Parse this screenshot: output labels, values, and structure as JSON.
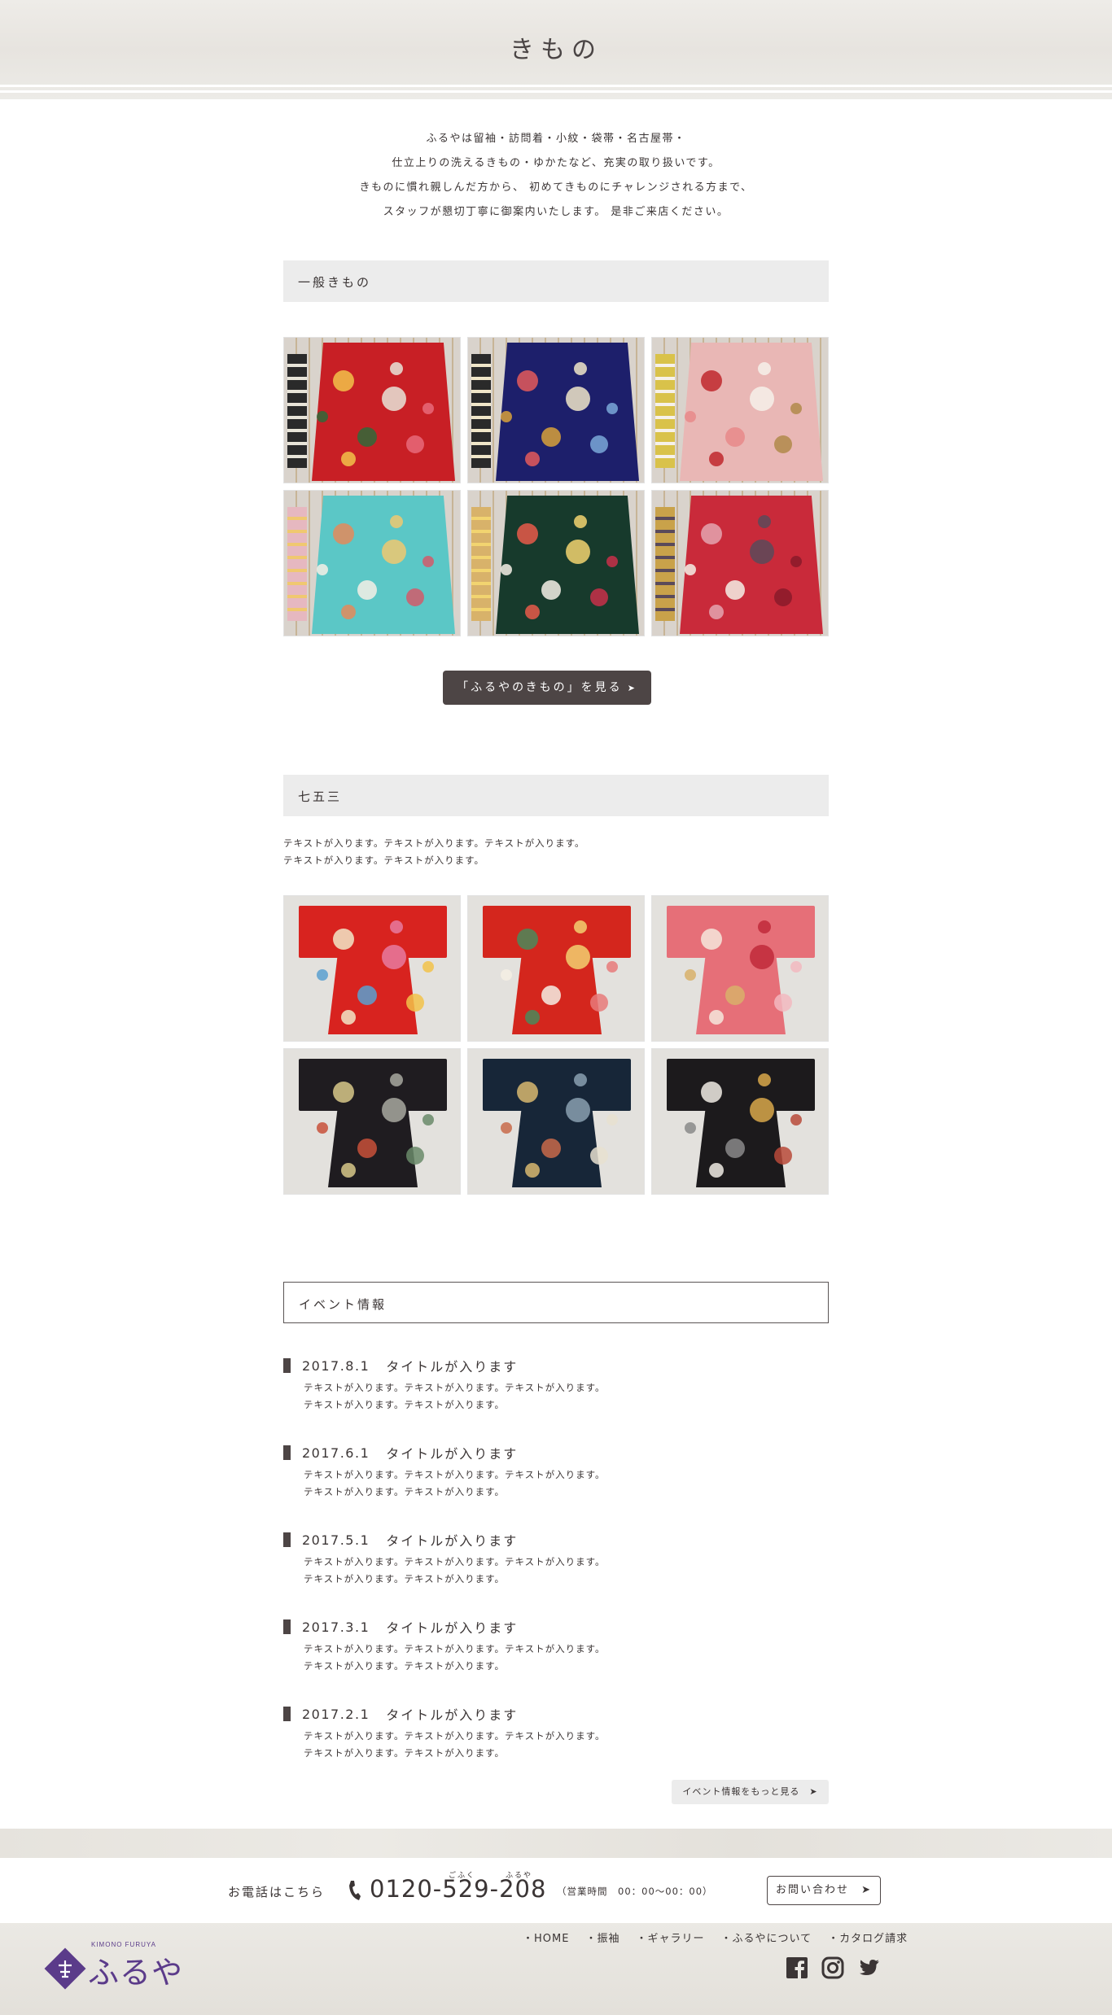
{
  "header": {
    "title": "きもの"
  },
  "intro": {
    "lines": [
      "ふるやは留袖・訪問着・小紋・袋帯・名古屋帯・",
      "仕立上りの洗えるきもの・ゆかたなど、充実の取り扱いです。",
      "きものに慣れ親しんだ方から、 初めてきものにチャレンジされる方まで、",
      "スタッフが懇切丁寧に御案内いたします。 是非ご来店ください。"
    ]
  },
  "sections": {
    "general": {
      "title": "一般きもの",
      "button_label": "「ふるやのきもの」を見る"
    },
    "shichigosan": {
      "title": "七五三",
      "text_lines": [
        "テキストが入ります。テキストが入ります。テキストが入ります。",
        "テキストが入ります。テキストが入ります。"
      ]
    },
    "events": {
      "title": "イベント情報",
      "items": [
        {
          "date": "2017.8.1",
          "title": "タイトルが入ります",
          "lines": [
            "テキストが入ります。テキストが入ります。テキストが入ります。",
            "テキストが入ります。テキストが入ります。"
          ]
        },
        {
          "date": "2017.6.1",
          "title": "タイトルが入ります",
          "lines": [
            "テキストが入ります。テキストが入ります。テキストが入ります。",
            "テキストが入ります。テキストが入ります。"
          ]
        },
        {
          "date": "2017.5.1",
          "title": "タイトルが入ります",
          "lines": [
            "テキストが入ります。テキストが入ります。テキストが入ります。",
            "テキストが入ります。テキストが入ります。"
          ]
        },
        {
          "date": "2017.3.1",
          "title": "タイトルが入ります",
          "lines": [
            "テキストが入ります。テキストが入ります。テキストが入ります。",
            "テキストが入ります。テキストが入ります。"
          ]
        },
        {
          "date": "2017.2.1",
          "title": "タイトルが入ります",
          "lines": [
            "テキストが入ります。テキストが入ります。テキストが入ります。",
            "テキストが入ります。テキストが入ります。"
          ]
        }
      ],
      "more_label": "イベント情報をもっと見る"
    }
  },
  "contact": {
    "label": "お電話はこちら",
    "ruby_left": "ごふく",
    "ruby_right": "ふるや",
    "phone": "0120-529-208",
    "hours": "（営業時間　00：00〜00：00）",
    "button_label": "お問い合わせ"
  },
  "footer": {
    "logo_sub": "KIMONO FURUYA",
    "logo_text": "ふるや",
    "nav": [
      "・HOME",
      "・振袖",
      "・ギャラリー",
      "・ふるやについて",
      "・カタログ請求"
    ],
    "social": [
      "facebook-icon",
      "instagram-icon",
      "twitter-icon"
    ]
  },
  "colors": {
    "accent": "#4d4545",
    "bar_bg": "#ececec",
    "brand_purple": "#5b3b8a"
  },
  "images": {
    "general": [
      {
        "bg": "#d9d3cc",
        "robe": "#c81f25",
        "obi": "#2a2a2a",
        "pattern": [
          "#f2c24a",
          "#e8e4d8",
          "#2f6a3a",
          "#e86a7a"
        ]
      },
      {
        "bg": "#d9d3cc",
        "robe": "#1d1f6b",
        "obi": "#2a2a2a",
        "pattern": [
          "#e45b5b",
          "#f0e6c8",
          "#d8a13a",
          "#7aa8d8"
        ]
      },
      {
        "bg": "#d9d3cc",
        "robe": "#e9b7b5",
        "obi": "#d9c24a",
        "pattern": [
          "#c0282d",
          "#f6f1ea",
          "#e88a8a",
          "#b08a4a"
        ]
      },
      {
        "bg": "#d9d3cc",
        "robe": "#5bc7c6",
        "obi": "#e6b8c0",
        "pattern": [
          "#e48a5a",
          "#f0c870",
          "#f5efe5",
          "#d25a6a"
        ]
      },
      {
        "bg": "#d9d3cc",
        "robe": "#173a2c",
        "obi": "#d8b26a",
        "pattern": [
          "#e85a4a",
          "#f2d470",
          "#f4f0e6",
          "#c8304a"
        ]
      },
      {
        "bg": "#d9d3cc",
        "robe": "#c92a3a",
        "obi": "#c9a24a",
        "pattern": [
          "#e4a4b0",
          "#5a4a5a",
          "#f4eee6",
          "#8a1a2a"
        ]
      }
    ],
    "shichigosan": [
      {
        "bg": "#e3e1dd",
        "robe": "#d8231f",
        "obi": "#d8231f",
        "pattern": [
          "#f2e6c8",
          "#e87aa0",
          "#5aa0d0",
          "#f2c24a"
        ]
      },
      {
        "bg": "#e3e1dd",
        "robe": "#d4261d",
        "obi": "#d4261d",
        "pattern": [
          "#4a8a5a",
          "#f2d070",
          "#f4efe4",
          "#e87a7a"
        ]
      },
      {
        "bg": "#e3e1dd",
        "robe": "#e66f78",
        "obi": "#e66f78",
        "pattern": [
          "#f4e8dc",
          "#c02a3a",
          "#d8b06a",
          "#f2b8c0"
        ]
      },
      {
        "bg": "#e3e1dd",
        "robe": "#1f1c20",
        "obi": "#1f1c20",
        "pattern": [
          "#d8c88a",
          "#a8a8a0",
          "#c8503a",
          "#6a8a6a"
        ]
      },
      {
        "bg": "#e3e1dd",
        "robe": "#172638",
        "obi": "#172638",
        "pattern": [
          "#d8b870",
          "#8aa0b0",
          "#c86a4a",
          "#e8e0d0"
        ]
      },
      {
        "bg": "#e3e1dd",
        "robe": "#1c1a1c",
        "obi": "#1c1a1c",
        "pattern": [
          "#f0ece4",
          "#d8a84a",
          "#8a8a8a",
          "#b84a3a"
        ]
      }
    ]
  }
}
